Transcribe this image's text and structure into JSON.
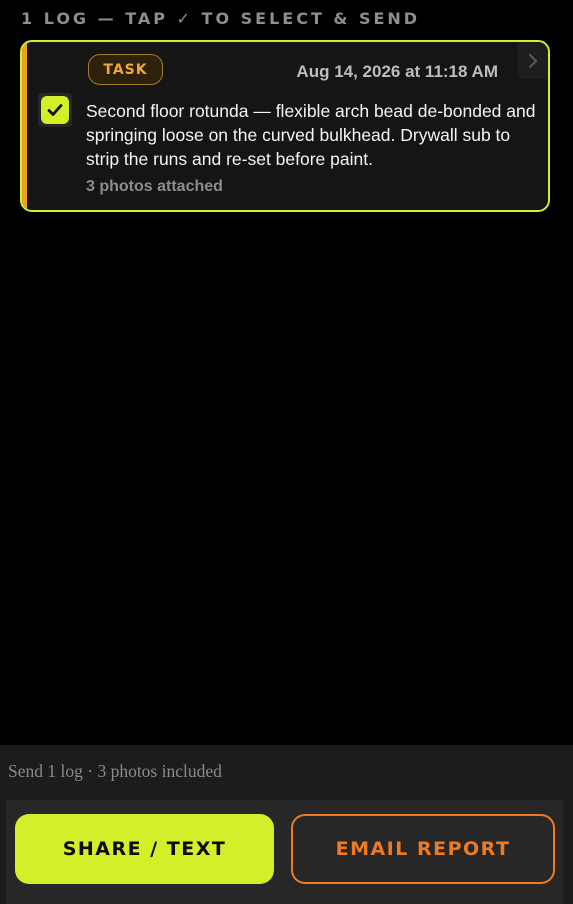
{
  "log_list": {
    "header": "1 LOG — TAP ✓ TO SELECT & SEND",
    "logs": [
      {
        "type": "TASK",
        "timestamp": "Aug 14, 2026 at 11:18 AM",
        "selected": true,
        "note": "Second floor rotunda — flexible arch bead de-bonded and springing loose on the curved bulkhead. Drywall sub to strip the runs and re-set before paint.",
        "photos": "3 photos attached"
      }
    ]
  },
  "footer": {
    "summary": "Send 1 log · 3 photos included",
    "share_label": "SHARE / TEXT",
    "email_label": "EMAIL REPORT"
  },
  "colors": {
    "accent": "#d2ef29",
    "task_tag": "#efa93a",
    "email": "#ee7a24",
    "card_stripe": "#f0a020"
  },
  "icons": {
    "checkbox": "check-icon",
    "chevron": "chevron-right-icon"
  }
}
